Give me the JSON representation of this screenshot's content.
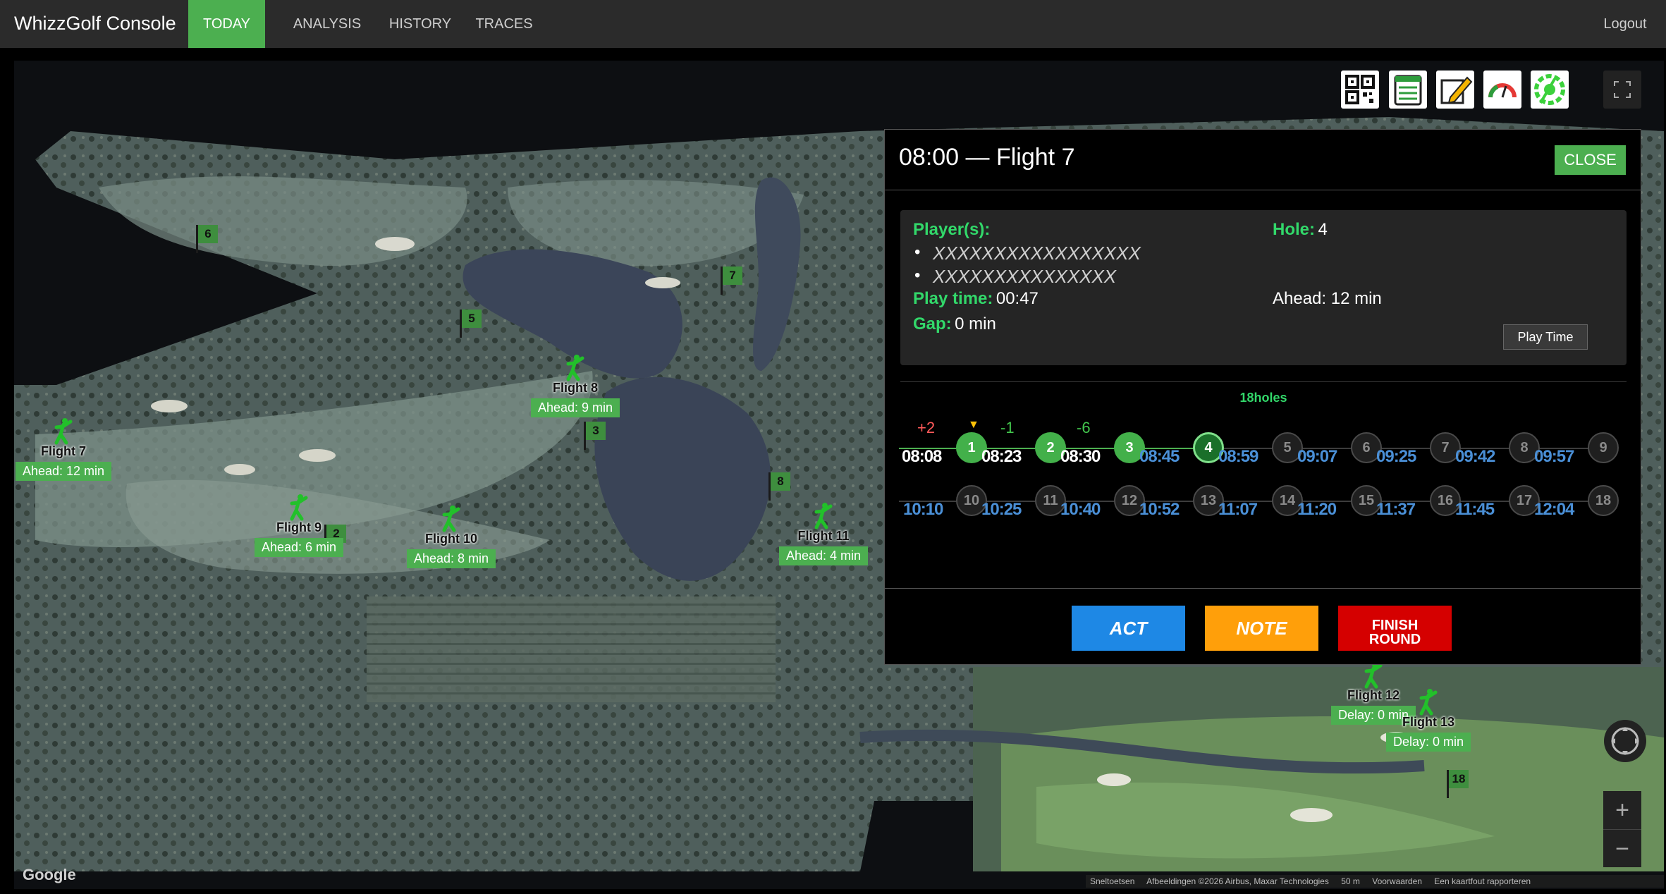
{
  "nav": {
    "brand": "WhizzGolf Console",
    "items": [
      {
        "label": "TODAY",
        "active": true
      },
      {
        "label": "ANALYSIS"
      },
      {
        "label": "HISTORY"
      },
      {
        "label": "TRACES"
      }
    ],
    "logout": "Logout"
  },
  "colors": {
    "accent": "#4caf50",
    "nav_bg": "#2b2b2b",
    "act": "#1e88e5",
    "note": "#ff9f0a",
    "finish": "#d50000"
  },
  "map": {
    "hole_flags": [
      "6",
      "7",
      "5",
      "3",
      "8",
      "2",
      "18"
    ],
    "flights": [
      {
        "title": "Flight 7",
        "label": "Ahead: 12 min"
      },
      {
        "title": "Flight 8",
        "label": "Ahead: 9 min"
      },
      {
        "title": "Flight 9",
        "label": "Ahead: 6 min"
      },
      {
        "title": "Flight 10",
        "label": "Ahead: 8 min"
      },
      {
        "title": "Flight 11",
        "label": "Ahead: 4 min"
      },
      {
        "title": "Flight 12",
        "label": "Delay: 0 min"
      },
      {
        "title": "Flight 13",
        "label": "Delay: 0 min"
      }
    ],
    "toolbar_icons": [
      "qr-code-icon",
      "spreadsheet-icon",
      "edit-icon",
      "speedometer-icon",
      "golf-settings-icon"
    ],
    "google": "Google",
    "attribution": [
      "Sneltoetsen",
      "Afbeeldingen ©2026 Airbus, Maxar Technologies",
      "50 m",
      "Voorwaarden",
      "Een kaartfout rapporteren"
    ],
    "zoom_in": "+",
    "zoom_out": "−"
  },
  "popup": {
    "title": "08:00 — Flight 7",
    "close": "CLOSE",
    "players_label": "Player(s):",
    "players": [
      "XXXXXXXXXXXXXXXXX",
      "XXXXXXXXXXXXXXX"
    ],
    "hole_label": "Hole:",
    "hole_value": "4",
    "play_time_label": "Play time:",
    "play_time_value": "00:47",
    "ahead_text": "Ahead: 12 min",
    "gap_label": "Gap:",
    "gap_value": "0 min",
    "play_time_button": "Play Time",
    "holes_title": "18holes",
    "start_time": "08:08",
    "back_start_time": "10:10",
    "holes": [
      {
        "n": "1",
        "time": "08:23",
        "status": "done",
        "delta": "+2"
      },
      {
        "n": "2",
        "time": "08:30",
        "status": "done",
        "delta": "-1"
      },
      {
        "n": "3",
        "time": "08:45",
        "status": "done",
        "delta": "-6"
      },
      {
        "n": "4",
        "time": "08:59",
        "status": "current"
      },
      {
        "n": "5",
        "time": "09:07",
        "status": "todo"
      },
      {
        "n": "6",
        "time": "09:25",
        "status": "todo"
      },
      {
        "n": "7",
        "time": "09:42",
        "status": "todo"
      },
      {
        "n": "8",
        "time": "09:57",
        "status": "todo"
      },
      {
        "n": "9",
        "time": "",
        "status": "todo"
      },
      {
        "n": "10",
        "time": "10:25",
        "status": "todo"
      },
      {
        "n": "11",
        "time": "10:40",
        "status": "todo"
      },
      {
        "n": "12",
        "time": "10:52",
        "status": "todo"
      },
      {
        "n": "13",
        "time": "11:07",
        "status": "todo"
      },
      {
        "n": "14",
        "time": "11:20",
        "status": "todo"
      },
      {
        "n": "15",
        "time": "11:37",
        "status": "todo"
      },
      {
        "n": "16",
        "time": "11:45",
        "status": "todo"
      },
      {
        "n": "17",
        "time": "12:04",
        "status": "todo"
      },
      {
        "n": "18",
        "time": "",
        "status": "todo"
      }
    ],
    "buttons": {
      "act": "ACT",
      "note": "NOTE",
      "finish_line1": "FINISH",
      "finish_line2": "ROUND"
    }
  }
}
